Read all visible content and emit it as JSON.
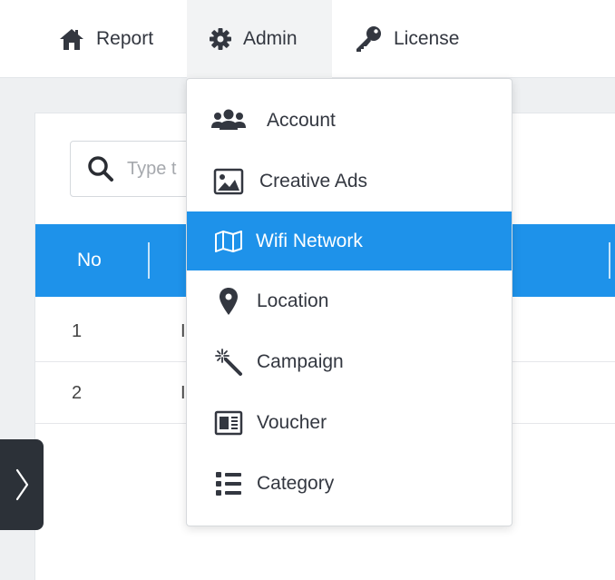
{
  "nav": {
    "report": "Report",
    "admin": "Admin",
    "license": "License"
  },
  "search": {
    "placeholder": "Type t"
  },
  "table": {
    "headers": [
      "No"
    ],
    "rows": [
      {
        "no": "1",
        "second": "I"
      },
      {
        "no": "2",
        "second": "I"
      }
    ]
  },
  "admin_menu": {
    "items": [
      {
        "label": "Account",
        "icon": "users-icon"
      },
      {
        "label": "Creative Ads",
        "icon": "image-icon"
      },
      {
        "label": "Wifi Network",
        "icon": "map-icon",
        "active": true
      },
      {
        "label": "Location",
        "icon": "map-pin-icon"
      },
      {
        "label": "Campaign",
        "icon": "magic-wand-icon"
      },
      {
        "label": "Voucher",
        "icon": "newspaper-icon"
      },
      {
        "label": "Category",
        "icon": "list-icon"
      }
    ]
  },
  "colors": {
    "accent": "#1e92ea",
    "sidebar_toggle": "#2c3138",
    "text": "#333740"
  }
}
